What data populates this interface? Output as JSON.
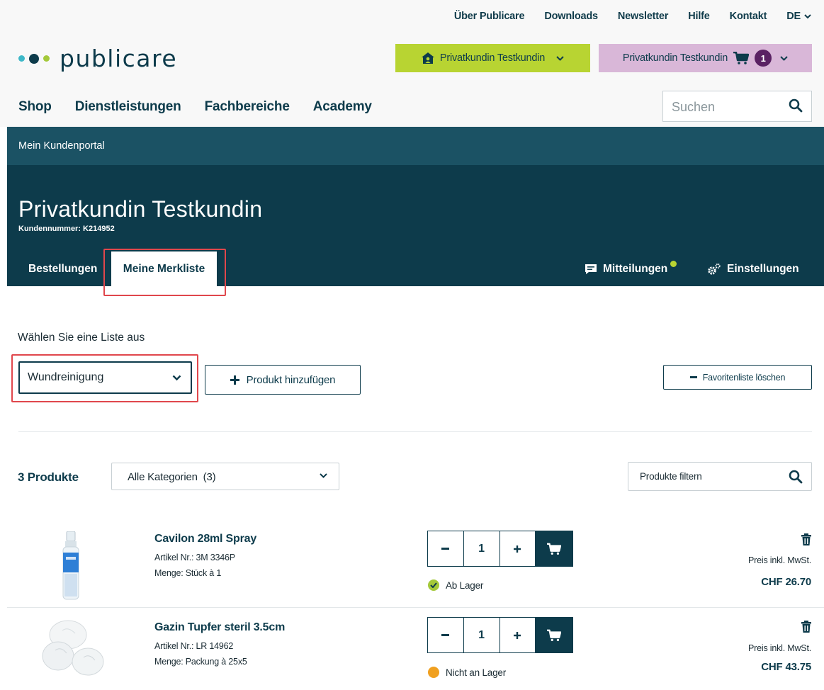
{
  "topnav": {
    "items": [
      "Über Publicare",
      "Downloads",
      "Newsletter",
      "Hilfe",
      "Kontakt"
    ],
    "language": "DE"
  },
  "header": {
    "logo_text": "publicare",
    "account_label": "Privatkundin Testkundin",
    "cart_label": "Privatkundin Testkundin",
    "cart_count": "1"
  },
  "mainnav": {
    "items": [
      "Shop",
      "Dienstleistungen",
      "Fachbereiche",
      "Academy"
    ],
    "search_placeholder": "Suchen"
  },
  "portal": {
    "breadcrumb": "Mein Kundenportal",
    "title": "Privatkundin Testkundin",
    "customer_number": "Kundennummer: K214952",
    "tabs": {
      "orders": "Bestellungen",
      "wishlist": "Meine Merkliste",
      "messages": "Mitteilungen",
      "settings": "Einstellungen"
    }
  },
  "list": {
    "choose_label": "Wählen Sie eine Liste aus",
    "selected": "Wundreinigung",
    "add_button": "Produkt hinzufügen",
    "clear_button": "Favoritenliste löschen"
  },
  "products_bar": {
    "count_label": "3 Produkte",
    "category_selected": "Alle Kategorien  (3)",
    "filter_placeholder": "Produkte filtern"
  },
  "products": [
    {
      "name": "Cavilon 28ml Spray",
      "article": "Artikel Nr.: 3M 3346P",
      "quantity_unit": "Menge: Stück à 1",
      "qty": "1",
      "stock": "Ab Lager",
      "price_label": "Preis inkl. MwSt.",
      "price": "CHF 26.70"
    },
    {
      "name": "Gazin Tupfer steril 3.5cm",
      "article": "Artikel Nr.: LR 14962",
      "quantity_unit": "Menge: Packung à 25x5",
      "qty": "1",
      "stock": "Nicht an Lager",
      "price_label": "Preis inkl. MwSt.",
      "price": "CHF 43.75"
    }
  ],
  "colors": {
    "brand_dark": "#0d3b4b",
    "brand_teal": "#1b5264",
    "accent_green": "#b8d432",
    "accent_pink": "#d9b7d8",
    "badge_purple": "#5a2163",
    "highlight_red": "#e0474c",
    "stock_ok": "#a4c93a",
    "stock_warn": "#f0a020"
  }
}
